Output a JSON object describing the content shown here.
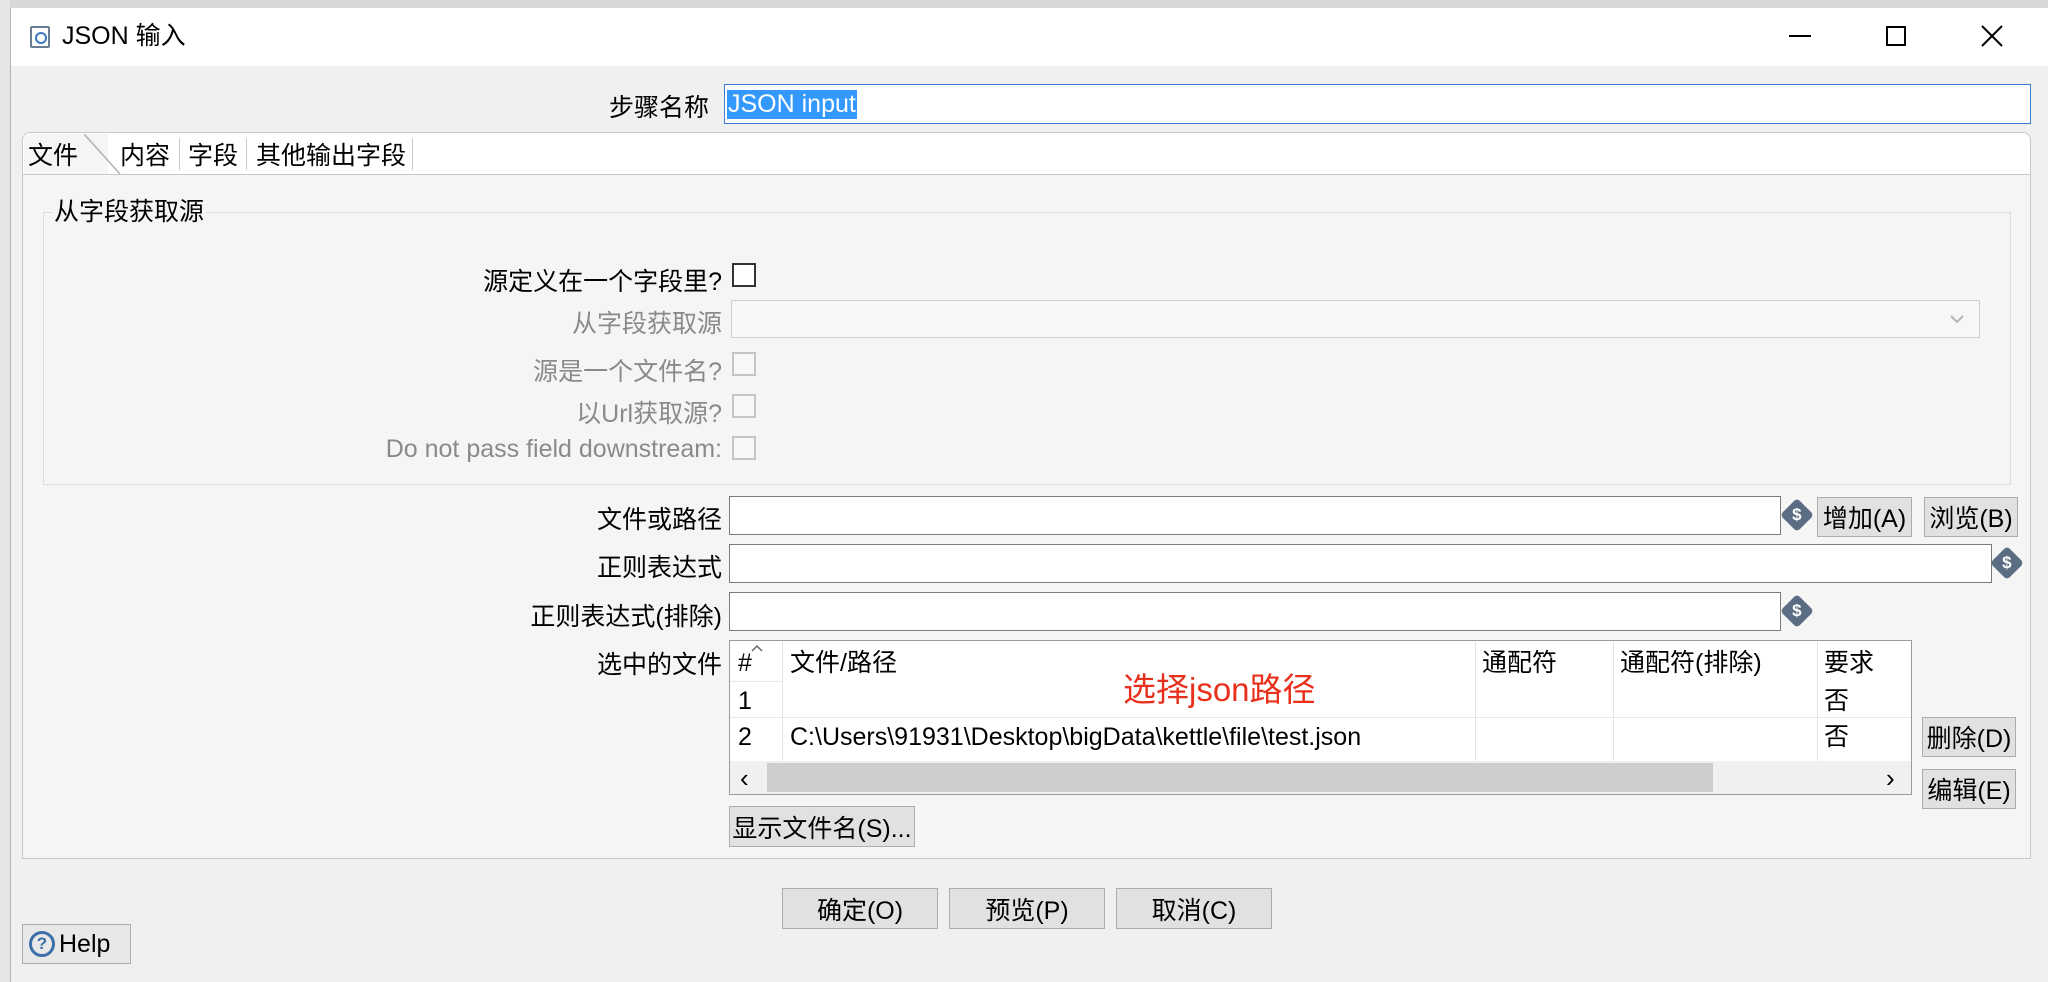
{
  "window": {
    "title": "JSON 输入",
    "minimize_glyph": "─",
    "maximize_glyph": "☐",
    "close_glyph": "✕"
  },
  "step_name": {
    "label": "步骤名称",
    "value": "JSON input"
  },
  "tabs": [
    {
      "label": "文件"
    },
    {
      "label": "内容"
    },
    {
      "label": "字段"
    },
    {
      "label": "其他输出字段"
    }
  ],
  "source_group": {
    "title": "从字段获取源",
    "source_in_field_label": "源定义在一个字段里?",
    "get_source_from_field_label": "从字段获取源",
    "source_is_filename_label": "源是一个文件名?",
    "read_source_as_url_label": "以Url获取源?",
    "do_not_pass_label": "Do not pass field downstream:"
  },
  "file_section": {
    "file_or_dir_label": "文件或路径",
    "regex_label": "正则表达式",
    "regex_exclude_label": "正则表达式(排除)",
    "selected_files_label": "选中的文件",
    "add_button": "增加(A)",
    "browse_button": "浏览(B)",
    "delete_button": "删除(D)",
    "edit_button": "编辑(E)",
    "show_filenames_button": "显示文件名(S)...",
    "variable_icon_glyph": "$"
  },
  "files_table": {
    "columns": [
      "#",
      "文件/路径",
      "通配符",
      "通配符(排除)",
      "要求"
    ],
    "rows": [
      {
        "num": "1",
        "path": "",
        "wildcard": "",
        "wildcard_exclude": "",
        "required": "否"
      },
      {
        "num": "2",
        "path": "C:\\Users\\91931\\Desktop\\bigData\\kettle\\file\\test.json",
        "wildcard": "",
        "wildcard_exclude": "",
        "required": "否"
      }
    ],
    "annotation": "选择json路径",
    "scroll_left": "‹",
    "scroll_right": "›"
  },
  "footer": {
    "ok_button": "确定(O)",
    "preview_button": "预览(P)",
    "cancel_button": "取消(C)",
    "help_button": "Help",
    "help_glyph": "?"
  },
  "colors": {
    "annotation": "#e8301c",
    "selection_bg": "#3399ff",
    "variable_icon": "#5a6d82",
    "help_icon": "#3d6ea8"
  }
}
